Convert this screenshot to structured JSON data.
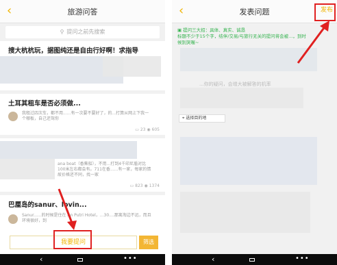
{
  "left": {
    "title": "旅游问答",
    "back_icon": "‹",
    "search_placeholder": "提问之前先搜索",
    "questions": [
      {
        "title": "搜大杭杭玩，据图纯还是自由行好啊！求指导",
        "body": "",
        "stats": ""
      },
      {
        "title": "土耳其租车是否必须做...",
        "body": "我租过四次车，都不用......有一次要不要好了，的...打算从网上下我一个哪板，自己还驾你",
        "comments": "23",
        "views": "605"
      },
      {
        "title": "",
        "body": "ana boat（香蕉船），不用...打到4千印尼盾对比100米左右都会有。711在香......有一家，每家的情故价格还不同，找一家",
        "comments": "823",
        "views": "1374"
      },
      {
        "title": "巴厘岛的sanur、lovin...",
        "body": "Sanur......的时候是住在 An Putri Hotel，...30....那离淘边不远，而且环境很好，到"
      }
    ],
    "ask_label": "我要提问",
    "filter_label": "筛选"
  },
  "right": {
    "title": "发表问题",
    "publish_label": "发布",
    "tip_line1": "提问三大招：具体、真实、诚恳",
    "tip_line2": "标题不少于15个字，结伴/交易/与旅行无关的提问将会被...，到时",
    "tip_line3": "候别哭喔~",
    "body_placeholder": "...你的疑问，会增大被解答的机率",
    "location_label": "选择目的地"
  },
  "colors": {
    "accent": "#f0b400",
    "highlight": "#e02020",
    "tip_green": "#34b34e"
  }
}
